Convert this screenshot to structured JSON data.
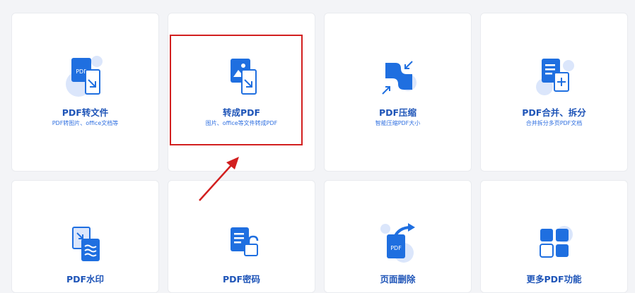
{
  "colors": {
    "accent": "#1f6fe0",
    "accent_dark": "#1f55b8",
    "accent_light": "#dbe6fb",
    "highlight": "#d21f1f"
  },
  "tools": [
    {
      "title": "PDF转文件",
      "desc": "PDF转图片、office文档等",
      "icon": "pdf-convert-icon",
      "icon_text": "PDF"
    },
    {
      "title": "转成PDF",
      "desc": "图片、office等文件转成PDF",
      "icon": "image-to-pdf-icon"
    },
    {
      "title": "PDF压缩",
      "desc": "智能压缩PDF大小",
      "icon": "compress-icon"
    },
    {
      "title": "PDF合并、拆分",
      "desc": "合并拆分多页PDF文档",
      "icon": "merge-split-icon"
    },
    {
      "title": "PDF水印",
      "desc": "",
      "icon": "watermark-icon"
    },
    {
      "title": "PDF密码",
      "desc": "",
      "icon": "password-lock-icon"
    },
    {
      "title": "页面删除",
      "desc": "",
      "icon": "page-delete-icon",
      "icon_text": "PDF"
    },
    {
      "title": "更多PDF功能",
      "desc": "",
      "icon": "more-features-icon"
    }
  ]
}
